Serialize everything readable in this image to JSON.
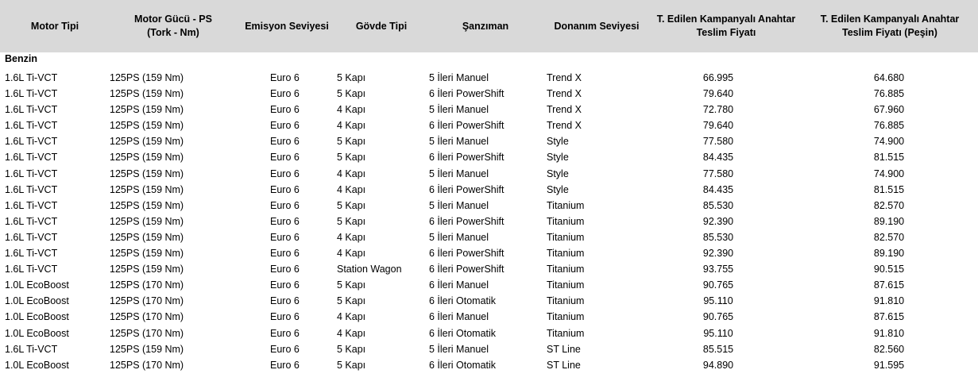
{
  "headers": [
    "Motor Tipi",
    "Motor Gücü - PS\n(Tork - Nm)",
    "Emisyon Seviyesi",
    "Gövde Tipi",
    "Şanzıman",
    "Donanım Seviyesi",
    "T. Edilen Kampanyalı Anahtar\nTeslim Fiyatı",
    "T. Edilen Kampanyalı Anahtar\nTeslim Fiyatı (Peşin)"
  ],
  "section_label": "Benzin",
  "rows": [
    [
      "1.6L Ti-VCT",
      "125PS (159 Nm)",
      "Euro 6",
      "5 Kapı",
      "5 İleri Manuel",
      "Trend X",
      "66.995",
      "64.680"
    ],
    [
      "1.6L Ti-VCT",
      "125PS (159 Nm)",
      "Euro 6",
      "5 Kapı",
      "6 İleri PowerShift",
      "Trend X",
      "79.640",
      "76.885"
    ],
    [
      "1.6L Ti-VCT",
      "125PS (159 Nm)",
      "Euro 6",
      "4 Kapı",
      "5 İleri Manuel",
      "Trend X",
      "72.780",
      "67.960"
    ],
    [
      "1.6L Ti-VCT",
      "125PS (159 Nm)",
      "Euro 6",
      "4 Kapı",
      "6 İleri PowerShift",
      "Trend X",
      "79.640",
      "76.885"
    ],
    [
      "1.6L Ti-VCT",
      "125PS (159 Nm)",
      "Euro 6",
      "5 Kapı",
      "5 İleri Manuel",
      "Style",
      "77.580",
      "74.900"
    ],
    [
      "1.6L Ti-VCT",
      "125PS (159 Nm)",
      "Euro 6",
      "5 Kapı",
      "6 İleri PowerShift",
      "Style",
      "84.435",
      "81.515"
    ],
    [
      "1.6L Ti-VCT",
      "125PS (159 Nm)",
      "Euro 6",
      "4 Kapı",
      "5 İleri Manuel",
      "Style",
      "77.580",
      "74.900"
    ],
    [
      "1.6L Ti-VCT",
      "125PS (159 Nm)",
      "Euro 6",
      "4 Kapı",
      "6 İleri PowerShift",
      "Style",
      "84.435",
      "81.515"
    ],
    [
      "1.6L Ti-VCT",
      "125PS (159 Nm)",
      "Euro 6",
      "5 Kapı",
      "5 İleri Manuel",
      "Titanium",
      "85.530",
      "82.570"
    ],
    [
      "1.6L Ti-VCT",
      "125PS (159 Nm)",
      "Euro 6",
      "5 Kapı",
      "6 İleri PowerShift",
      "Titanium",
      "92.390",
      "89.190"
    ],
    [
      "1.6L Ti-VCT",
      "125PS (159 Nm)",
      "Euro 6",
      "4 Kapı",
      "5 İleri Manuel",
      "Titanium",
      "85.530",
      "82.570"
    ],
    [
      "1.6L Ti-VCT",
      "125PS (159 Nm)",
      "Euro 6",
      "4 Kapı",
      "6 İleri PowerShift",
      "Titanium",
      "92.390",
      "89.190"
    ],
    [
      "1.6L Ti-VCT",
      "125PS (159 Nm)",
      "Euro 6",
      "Station Wagon",
      "6 İleri PowerShift",
      "Titanium",
      "93.755",
      "90.515"
    ],
    [
      "1.0L EcoBoost",
      "125PS (170 Nm)",
      "Euro 6",
      "5 Kapı",
      "6 İleri Manuel",
      "Titanium",
      "90.765",
      "87.615"
    ],
    [
      "1.0L EcoBoost",
      "125PS (170 Nm)",
      "Euro 6",
      "5 Kapı",
      "6 İleri Otomatik",
      "Titanium",
      "95.110",
      "91.810"
    ],
    [
      "1.0L EcoBoost",
      "125PS (170 Nm)",
      "Euro 6",
      "4 Kapı",
      "6 İleri Manuel",
      "Titanium",
      "90.765",
      "87.615"
    ],
    [
      "1.0L EcoBoost",
      "125PS (170 Nm)",
      "Euro 6",
      "4 Kapı",
      "6 İleri Otomatik",
      "Titanium",
      "95.110",
      "91.810"
    ],
    [
      "1.6L Ti-VCT",
      "125PS (159 Nm)",
      "Euro 6",
      "5 Kapı",
      "5 İleri Manuel",
      "ST Line",
      "85.515",
      "82.560"
    ],
    [
      "1.0L EcoBoost",
      "125PS (170 Nm)",
      "Euro 6",
      "5 Kapı",
      "6 İleri Otomatik",
      "ST Line",
      "94.890",
      "91.595"
    ]
  ]
}
